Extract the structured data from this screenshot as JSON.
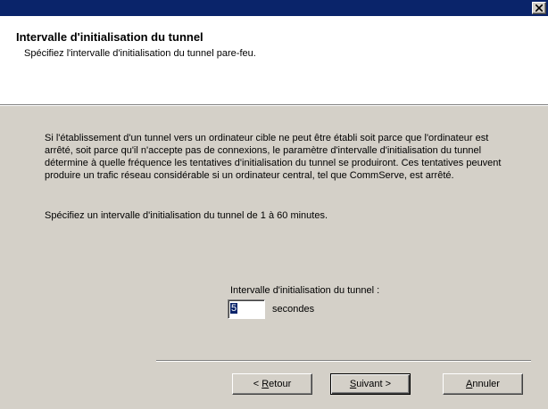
{
  "window": {
    "title": "",
    "close_icon": "close-icon"
  },
  "header": {
    "title": "Intervalle d'initialisation du tunnel",
    "subtitle": "Spécifiez l'intervalle d'initialisation du tunnel pare-feu."
  },
  "body": {
    "description": "Si l'établissement d'un tunnel vers un ordinateur cible ne peut être établi soit parce que l'ordinateur est arrêté, soit parce qu'il n'accepte pas de connexions, le paramètre d'intervalle d'initialisation du tunnel détermine à quelle fréquence les tentatives d'initialisation du tunnel se produiront.  Ces tentatives peuvent produire un trafic réseau considérable si un ordinateur central, tel que CommServe, est arrêté.",
    "instruction": "Spécifiez un intervalle d'initialisation du tunnel de 1 à 60 minutes."
  },
  "interval_field": {
    "label": "Intervalle d'initialisation du tunnel :",
    "value": "5",
    "unit": "secondes"
  },
  "buttons": {
    "back_prefix": "< ",
    "back_mnemonic": "R",
    "back_rest": "etour",
    "next_mnemonic": "S",
    "next_rest": "uivant >",
    "cancel_mnemonic": "A",
    "cancel_rest": "nnuler"
  },
  "colors": {
    "titlebar": "#0a246a",
    "dialog_face": "#d4d0c8",
    "header_background": "#ffffff"
  }
}
